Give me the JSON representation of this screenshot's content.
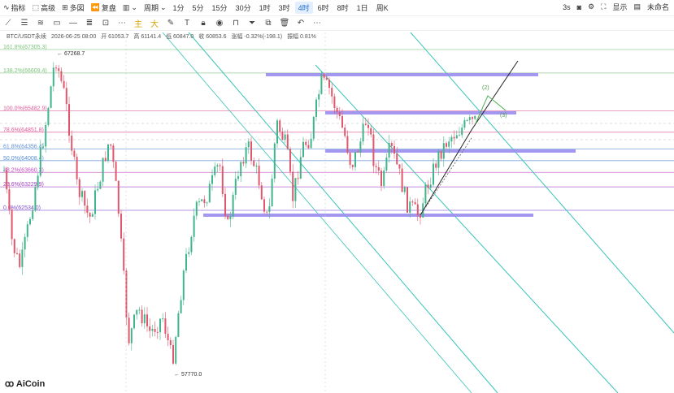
{
  "toolbar": {
    "indicators_label": "指标",
    "advanced_label": "高级",
    "multi_label": "多図",
    "replay_label": "复盘",
    "period_label": "周期",
    "periods": [
      "1分",
      "5分",
      "15分",
      "30分",
      "1时",
      "3时",
      "4时",
      "6时",
      "8时",
      "1日",
      "周K"
    ],
    "active_period": "4时",
    "interval_label": "3s",
    "display_label": "显示",
    "user_label": "未命名"
  },
  "legend": {
    "symbol": "BTC/USDT永续",
    "datetime": "2026-06-25 08:00",
    "open": "开 61053.7",
    "high": "高 61141.4",
    "low": "低 60847.0",
    "close": "收 60853.6",
    "change": "涨幅 -0.32%(-198.1)",
    "amplitude": "振幅 0.81%"
  },
  "fib_levels": [
    {
      "label": "161.8%(67305.3)",
      "price": 67305.3,
      "color": "#7cc47c"
    },
    {
      "label": "138.2%(66609.4)",
      "price": 66609.4,
      "color": "#7cc47c"
    },
    {
      "label": "100.0%(65482.9)",
      "price": 65482.9,
      "color": "#e05c9a"
    },
    {
      "label": "78.6%(64851.8)",
      "price": 64851.8,
      "color": "#e05c9a"
    },
    {
      "label": "61.8%(64356.4)",
      "price": 64356.4,
      "color": "#5b8fd6"
    },
    {
      "label": "50.0%(64008.4)",
      "price": 64008.4,
      "color": "#5b8fd6"
    },
    {
      "label": "38.2%(63660.3)",
      "price": 63660.3,
      "color": "#c050c0"
    },
    {
      "label": "23.6%(63229.9)",
      "price": 63229.9,
      "color": "#a040c0"
    },
    {
      "label": "0.0%(62534.0)",
      "price": 62534.0,
      "color": "#8050d0"
    }
  ],
  "annotations": {
    "high_marker": "67268.7",
    "low_marker": "57770.0",
    "wave2": "(2)",
    "wave3": "(3)"
  },
  "logo": "AiCoin",
  "colors": {
    "up": "#3fb58a",
    "down": "#e0566a",
    "channel": "#38c4b8",
    "zone": "#9a8cf0",
    "projection": "#222222"
  }
}
